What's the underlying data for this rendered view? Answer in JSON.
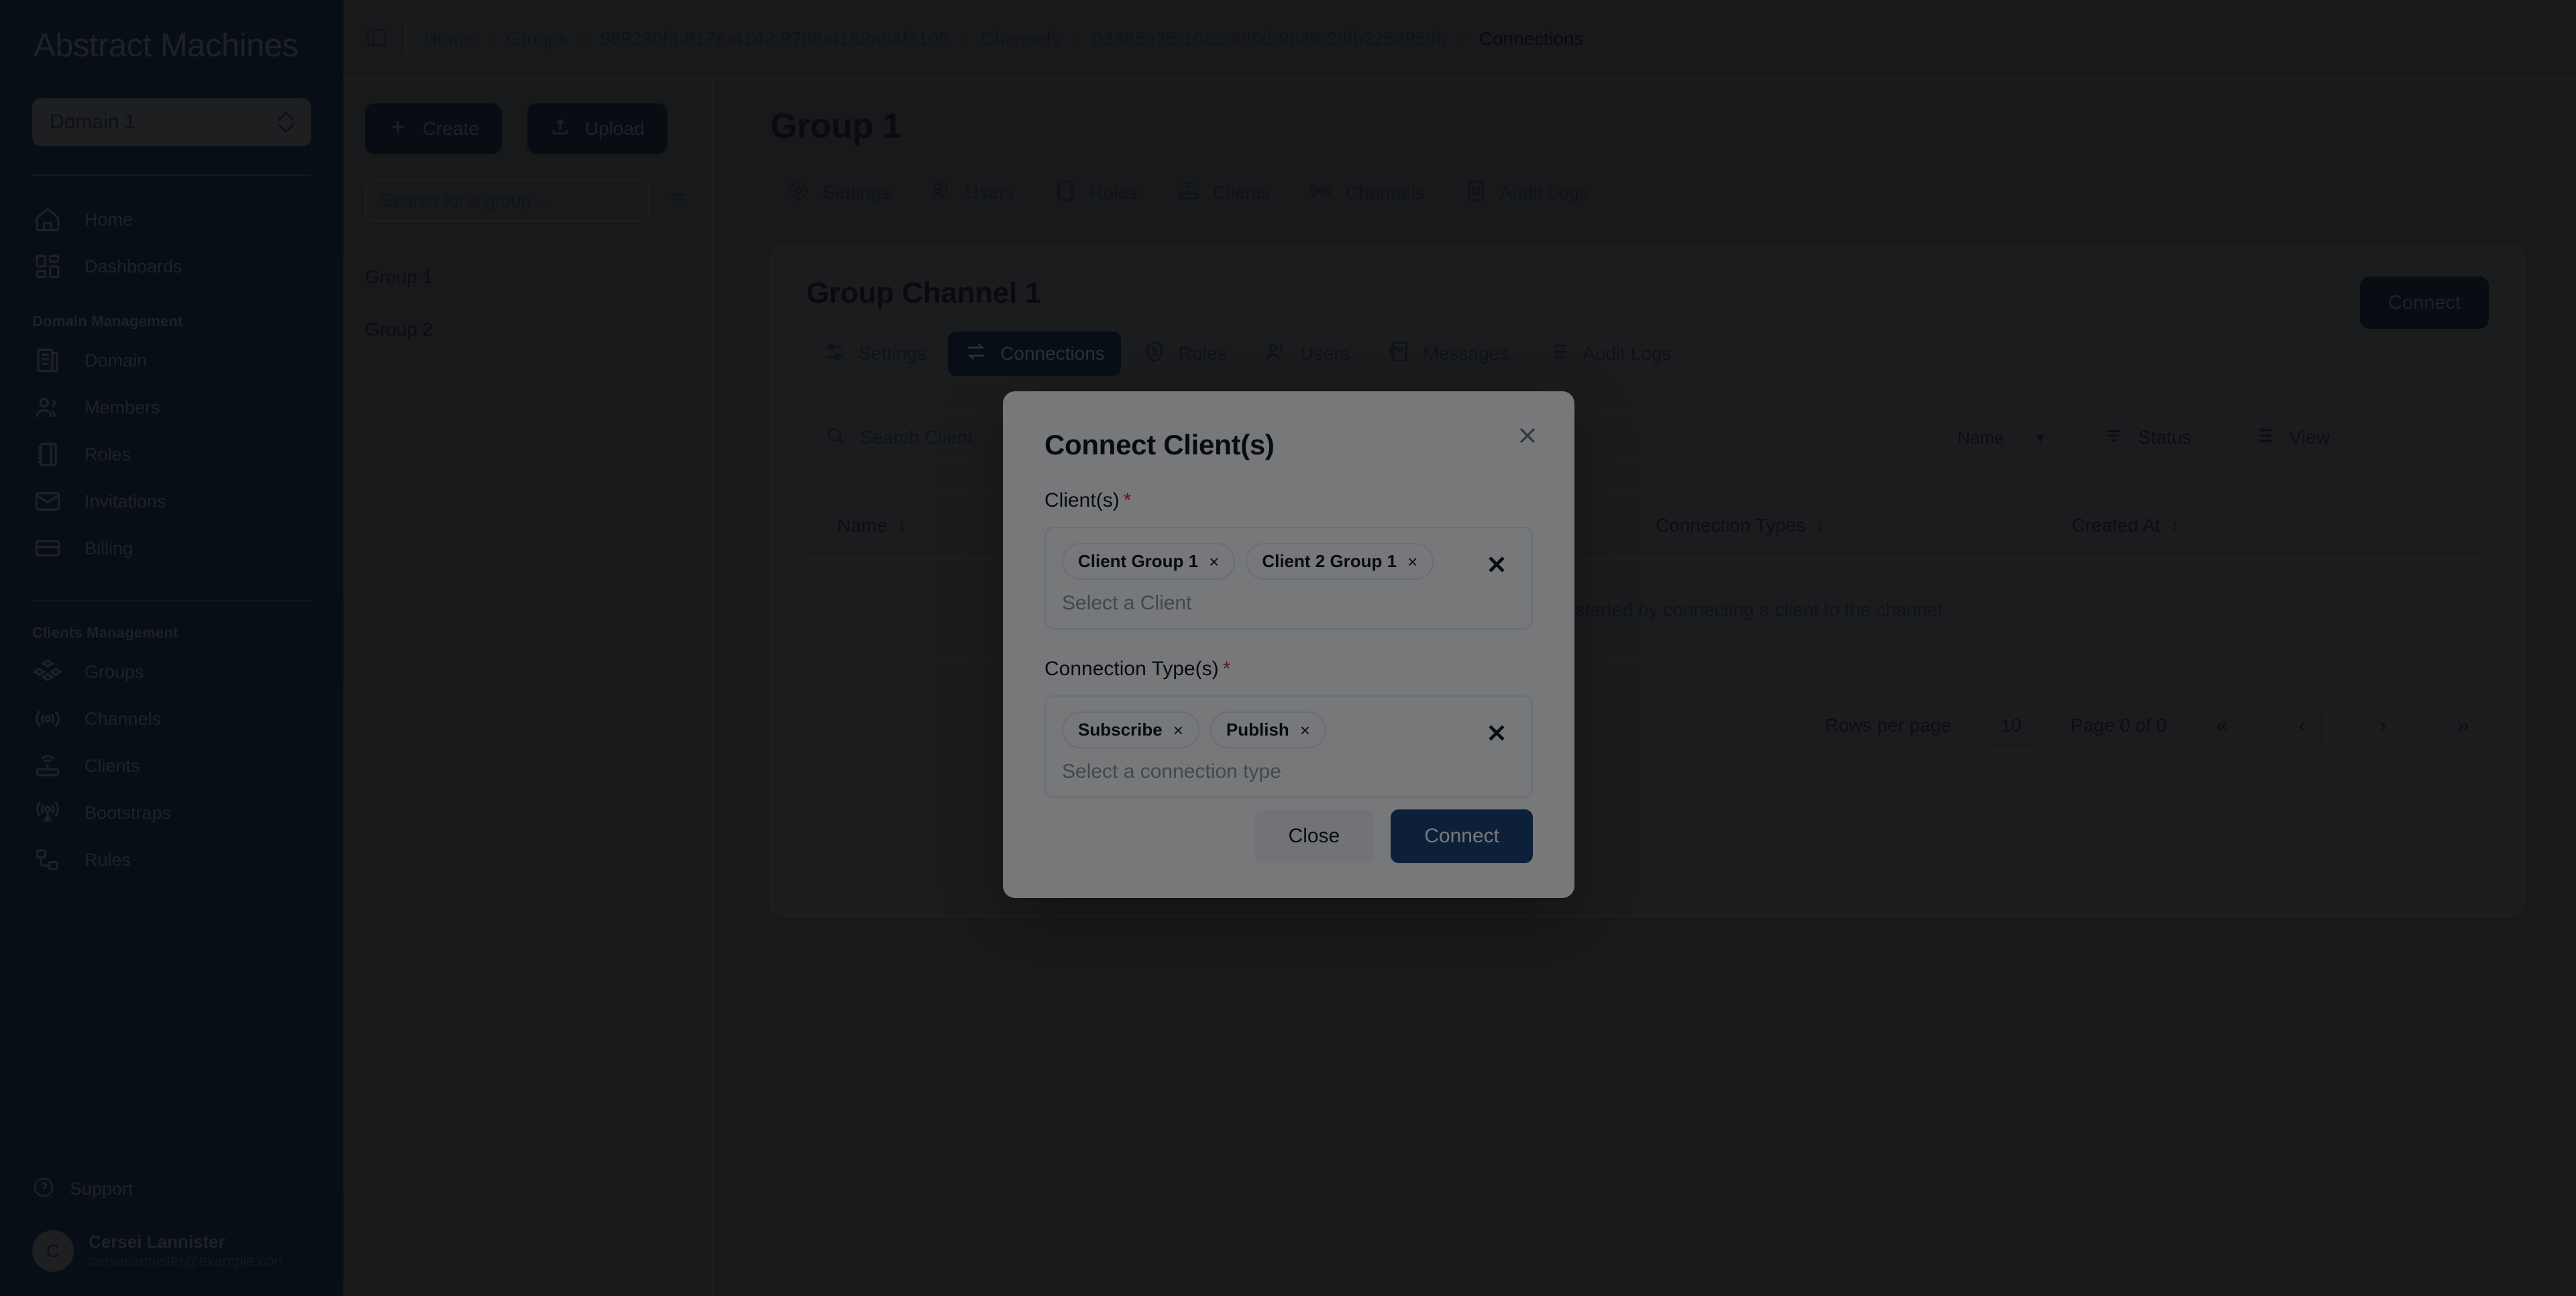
{
  "brand": {
    "name": "Abstract Machines"
  },
  "domain_selector": {
    "value": "Domain 1"
  },
  "sidebar": {
    "top_items": [
      {
        "label": "Home",
        "icon": "home-icon"
      },
      {
        "label": "Dashboards",
        "icon": "dashboards-icon"
      }
    ],
    "sections": [
      {
        "title": "Domain Management",
        "items": [
          {
            "label": "Domain",
            "icon": "domain-icon"
          },
          {
            "label": "Members",
            "icon": "members-icon"
          },
          {
            "label": "Roles",
            "icon": "roles-icon"
          },
          {
            "label": "Invitations",
            "icon": "invitations-icon"
          },
          {
            "label": "Billing",
            "icon": "billing-icon"
          }
        ]
      },
      {
        "title": "Clients Management",
        "items": [
          {
            "label": "Groups",
            "icon": "groups-icon"
          },
          {
            "label": "Channels",
            "icon": "channels-icon"
          },
          {
            "label": "Clients",
            "icon": "clients-icon"
          },
          {
            "label": "Bootstraps",
            "icon": "bootstraps-icon"
          },
          {
            "label": "Rules",
            "icon": "rules-icon"
          }
        ]
      }
    ],
    "support": {
      "label": "Support",
      "icon": "help-circle-icon"
    },
    "user": {
      "initial": "C",
      "name": "Cersei Lannister",
      "email": "cerseilannister@example.com"
    }
  },
  "breadcrumb": {
    "items": [
      {
        "label": "Home",
        "current": false
      },
      {
        "label": "Groups",
        "current": false
      },
      {
        "label": "989280f3-8176-4142-9708-4162a84f3105",
        "current": false
      },
      {
        "label": "Channels",
        "current": false
      },
      {
        "label": "03385a75-10a2-485d-9636-26fb2253959b",
        "current": false
      },
      {
        "label": "Connections",
        "current": true
      }
    ],
    "separator": "›"
  },
  "groups_panel": {
    "create_label": "Create",
    "upload_label": "Upload",
    "search_placeholder": "Search for a group ...",
    "search_value": "",
    "items": [
      {
        "label": "Group 1"
      },
      {
        "label": "Group 2"
      }
    ]
  },
  "page": {
    "title": "Group 1",
    "tabs": [
      {
        "label": "Settings",
        "icon": "gear-icon",
        "active": false
      },
      {
        "label": "Users",
        "icon": "users-icon",
        "active": false
      },
      {
        "label": "Roles",
        "icon": "roles-icon",
        "active": false
      },
      {
        "label": "Clients",
        "icon": "router-icon",
        "active": false
      },
      {
        "label": "Channels",
        "icon": "broadcast-icon",
        "active": false
      },
      {
        "label": "Audit Logs",
        "icon": "audit-icon",
        "active": false
      }
    ]
  },
  "channel_card": {
    "title": "Group Channel 1",
    "tabs": [
      {
        "label": "Settings",
        "icon": "sliders-icon",
        "active": false
      },
      {
        "label": "Connections",
        "icon": "exchange-icon",
        "active": true
      },
      {
        "label": "Roles",
        "icon": "badge-icon",
        "active": false
      },
      {
        "label": "Users",
        "icon": "users-icon",
        "active": false
      },
      {
        "label": "Messages",
        "icon": "message-icon",
        "active": false
      },
      {
        "label": "Audit Logs",
        "icon": "list-icon",
        "active": false
      }
    ],
    "connect_button": "Connect",
    "toolbar": {
      "search_placeholder": "Search Client",
      "search_value": "",
      "sort_value": "Name",
      "status_label": "Status",
      "view_label": "View"
    },
    "table": {
      "columns": [
        "Name",
        "",
        "Connection Types",
        "Created At"
      ],
      "empty_text": "No connections found. Get started by connecting a client to the channel.",
      "rows": []
    },
    "pagination": {
      "rows_per_page_label": "Rows per page",
      "rows_per_page_value": "10",
      "page_label": "Page 0 of 0",
      "first": "«",
      "prev": "‹",
      "next": "›",
      "last": "»"
    }
  },
  "modal": {
    "title": "Connect Client(s)",
    "close_icon": "close-icon",
    "clients_field": {
      "label": "Client(s)",
      "required_marker": "*",
      "chips": [
        {
          "label": "Client Group 1",
          "remove": "×"
        },
        {
          "label": "Client 2 Group 1",
          "remove": "×"
        }
      ],
      "placeholder": "Select a Client"
    },
    "connection_types_field": {
      "label": "Connection Type(s)",
      "required_marker": "*",
      "chips": [
        {
          "label": "Subscribe",
          "remove": "×"
        },
        {
          "label": "Publish",
          "remove": "×"
        }
      ],
      "placeholder": "Select a connection type"
    },
    "close_label": "Close",
    "connect_label": "Connect"
  },
  "colors": {
    "sidebar_bg": "#0a1420",
    "app_bg": "#2e2e2e",
    "modal_bg": "#ffffff",
    "primary": "#123d72",
    "required": "#dc2626",
    "chip_border": "#e3e8ef"
  }
}
